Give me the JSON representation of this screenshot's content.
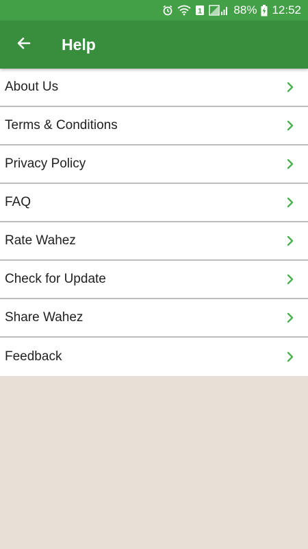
{
  "status_bar": {
    "battery": "88%",
    "time": "12:52",
    "sim_badge": "1",
    "icons": [
      "alarm-icon",
      "wifi-icon",
      "sim-icon",
      "signal-icon",
      "battery-charging-icon"
    ]
  },
  "app_bar": {
    "title": "Help",
    "back_icon": "arrow-left-icon",
    "color": "#388e3c"
  },
  "menu": {
    "items": [
      {
        "label": "About Us"
      },
      {
        "label": "Terms & Conditions"
      },
      {
        "label": "Privacy Policy"
      },
      {
        "label": "FAQ"
      },
      {
        "label": "Rate Wahez"
      },
      {
        "label": "Check for Update"
      },
      {
        "label": "Share Wahez"
      },
      {
        "label": "Feedback"
      }
    ],
    "chevron_icon": "chevron-right-icon",
    "chevron_color": "#4caf50"
  }
}
